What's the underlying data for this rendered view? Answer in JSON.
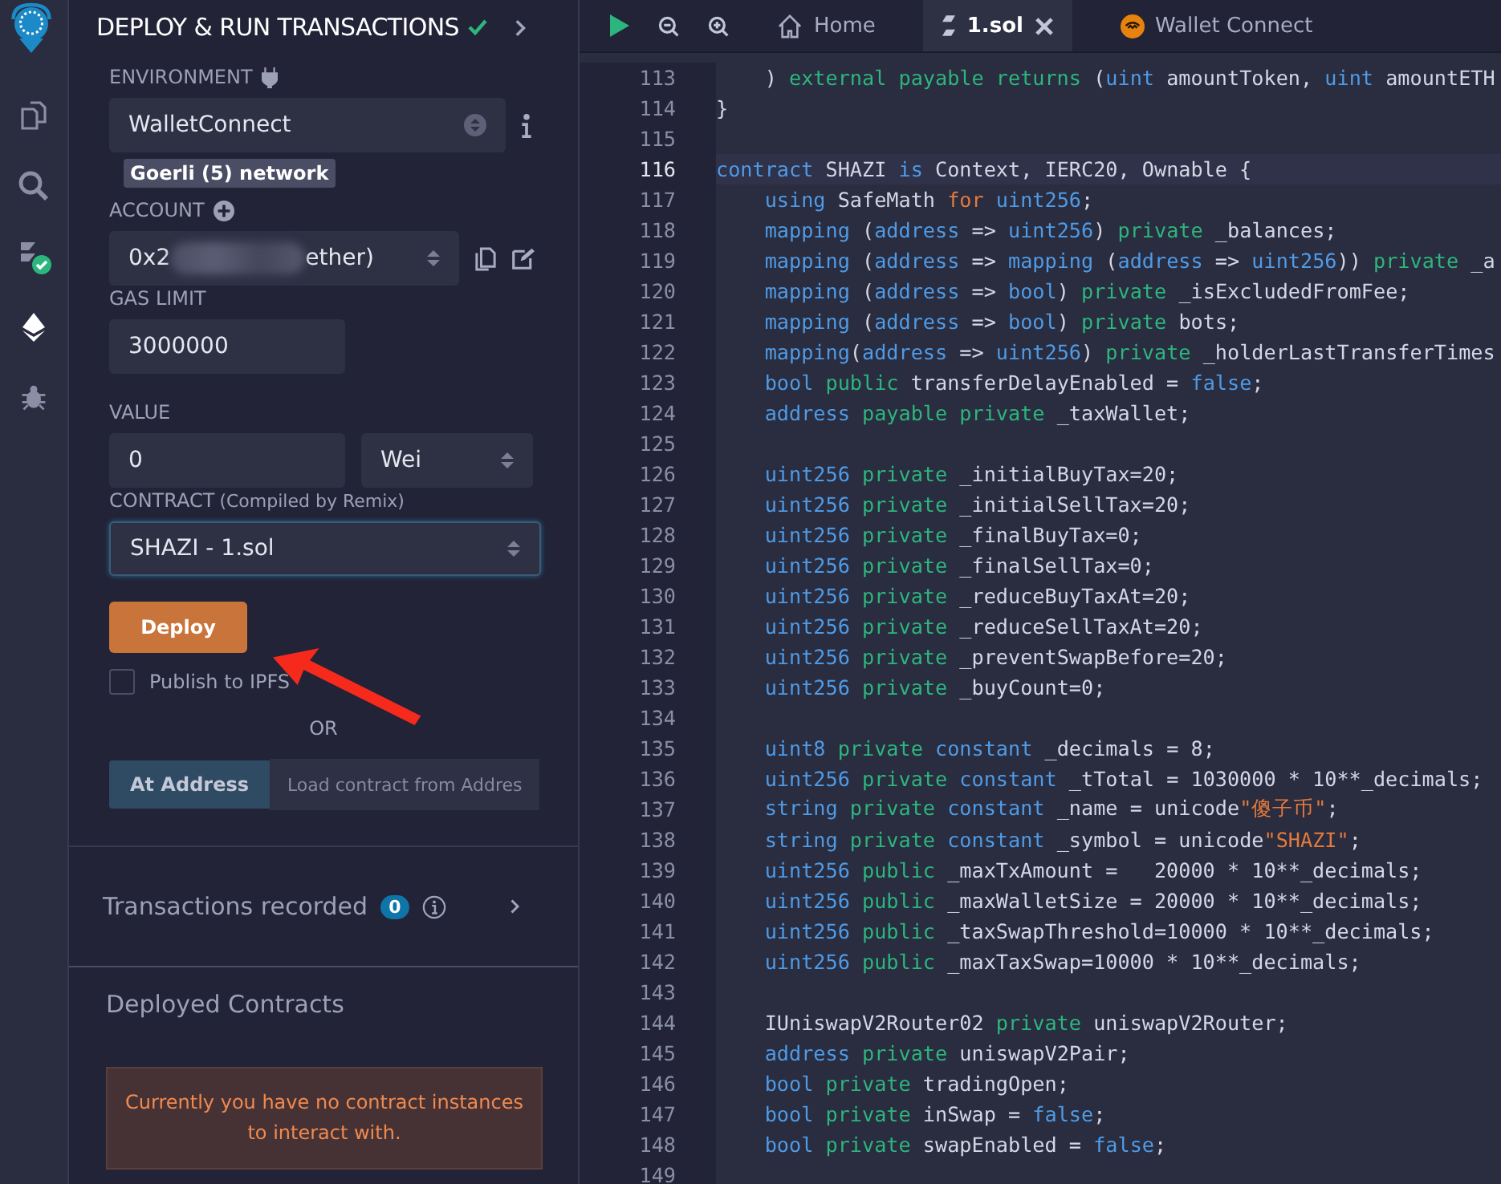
{
  "panel": {
    "title": "DEPLOY & RUN TRANSACTIONS",
    "environment_label": "ENVIRONMENT",
    "environment": "WalletConnect",
    "network": "Goerli (5) network",
    "account_label": "ACCOUNT",
    "account_start": "0x2",
    "account_end": "ether)",
    "gas_label": "GAS LIMIT",
    "gas": "3000000",
    "value_label": "VALUE",
    "value": "0",
    "unit": "Wei",
    "contract_label": "CONTRACT",
    "contract_note": "(Compiled by Remix)",
    "contract": "SHAZI - 1.sol",
    "deploy": "Deploy",
    "publish": {
      "label": "Publish to IPFS",
      "checked": false
    },
    "or": "OR",
    "at_address": "At Address",
    "address_placeholder": "Load contract from Addres",
    "transactions": "Transactions recorded",
    "tx_count": "0",
    "deployed": "Deployed Contracts",
    "empty_message": "Currently you have no contract instances to interact with."
  },
  "sidebar": {
    "items": [
      {
        "kind": "files",
        "selected": false
      },
      {
        "kind": "search",
        "selected": false
      },
      {
        "kind": "compiler",
        "selected": false
      },
      {
        "kind": "deploy",
        "selected": true
      },
      {
        "kind": "debug",
        "selected": false
      }
    ]
  },
  "tabs": [
    {
      "kind": "home",
      "label": "Home",
      "selected": false
    },
    {
      "kind": "file",
      "label": "1.sol",
      "selected": true
    },
    {
      "kind": "wallet",
      "label": "Wallet Connect",
      "selected": false
    }
  ],
  "editor": {
    "lines": [
      {
        "number": "113",
        "current": false,
        "tokens": [
          {
            "kind": "plain",
            "text": "    )"
          },
          {
            "kind": "modifier",
            "text": " external payable returns"
          },
          {
            "kind": "plain",
            "text": " ("
          },
          {
            "kind": "keyword",
            "text": "uint"
          },
          {
            "kind": "plain",
            "text": " amountToken,"
          },
          {
            "kind": "keyword",
            "text": " uint"
          },
          {
            "kind": "plain",
            "text": " amountETH"
          }
        ]
      },
      {
        "number": "114",
        "current": false,
        "tokens": [
          {
            "kind": "plain",
            "text": "}"
          }
        ]
      },
      {
        "number": "115",
        "current": false
      },
      {
        "number": "116",
        "current": true,
        "tokens": [
          {
            "kind": "keyword",
            "text": "contract"
          },
          {
            "kind": "plain",
            "text": " SHAZI"
          },
          {
            "kind": "keyword",
            "text": " is"
          },
          {
            "kind": "plain",
            "text": " Context, IERC20, Ownable {"
          }
        ]
      },
      {
        "number": "117",
        "current": false,
        "tokens": [
          {
            "kind": "keyword",
            "text": "    using"
          },
          {
            "kind": "plain",
            "text": " SafeMath"
          },
          {
            "kind": "string",
            "text": " for"
          },
          {
            "kind": "keyword",
            "text": " uint256"
          },
          {
            "kind": "plain",
            "text": ";"
          }
        ]
      },
      {
        "number": "118",
        "current": false,
        "tokens": [
          {
            "kind": "keyword",
            "text": "    mapping"
          },
          {
            "kind": "plain",
            "text": " ("
          },
          {
            "kind": "keyword",
            "text": "address"
          },
          {
            "kind": "plain",
            "text": " => "
          },
          {
            "kind": "keyword",
            "text": "uint256"
          },
          {
            "kind": "plain",
            "text": ")"
          },
          {
            "kind": "modifier",
            "text": " private"
          },
          {
            "kind": "plain",
            "text": " _balances;"
          }
        ]
      },
      {
        "number": "119",
        "current": false,
        "tokens": [
          {
            "kind": "keyword",
            "text": "    mapping"
          },
          {
            "kind": "plain",
            "text": " ("
          },
          {
            "kind": "keyword",
            "text": "address"
          },
          {
            "kind": "plain",
            "text": " => "
          },
          {
            "kind": "keyword",
            "text": "mapping"
          },
          {
            "kind": "plain",
            "text": " ("
          },
          {
            "kind": "keyword",
            "text": "address"
          },
          {
            "kind": "plain",
            "text": " => "
          },
          {
            "kind": "keyword",
            "text": "uint256"
          },
          {
            "kind": "plain",
            "text": "))"
          },
          {
            "kind": "modifier",
            "text": " private"
          },
          {
            "kind": "plain",
            "text": " _a"
          }
        ]
      },
      {
        "number": "120",
        "current": false,
        "tokens": [
          {
            "kind": "keyword",
            "text": "    mapping"
          },
          {
            "kind": "plain",
            "text": " ("
          },
          {
            "kind": "keyword",
            "text": "address"
          },
          {
            "kind": "plain",
            "text": " => "
          },
          {
            "kind": "keyword",
            "text": "bool"
          },
          {
            "kind": "plain",
            "text": ")"
          },
          {
            "kind": "modifier",
            "text": " private"
          },
          {
            "kind": "plain",
            "text": " _isExcludedFromFee;"
          }
        ]
      },
      {
        "number": "121",
        "current": false,
        "tokens": [
          {
            "kind": "keyword",
            "text": "    mapping"
          },
          {
            "kind": "plain",
            "text": " ("
          },
          {
            "kind": "keyword",
            "text": "address"
          },
          {
            "kind": "plain",
            "text": " => "
          },
          {
            "kind": "keyword",
            "text": "bool"
          },
          {
            "kind": "plain",
            "text": ")"
          },
          {
            "kind": "modifier",
            "text": " private"
          },
          {
            "kind": "plain",
            "text": " bots;"
          }
        ]
      },
      {
        "number": "122",
        "current": false,
        "tokens": [
          {
            "kind": "keyword",
            "text": "    mapping"
          },
          {
            "kind": "plain",
            "text": "("
          },
          {
            "kind": "keyword",
            "text": "address"
          },
          {
            "kind": "plain",
            "text": " => "
          },
          {
            "kind": "keyword",
            "text": "uint256"
          },
          {
            "kind": "plain",
            "text": ")"
          },
          {
            "kind": "modifier",
            "text": " private"
          },
          {
            "kind": "plain",
            "text": " _holderLastTransferTimes"
          }
        ]
      },
      {
        "number": "123",
        "current": false,
        "tokens": [
          {
            "kind": "keyword",
            "text": "    bool"
          },
          {
            "kind": "modifier",
            "text": " public"
          },
          {
            "kind": "plain",
            "text": " transferDelayEnabled = "
          },
          {
            "kind": "keyword",
            "text": "false"
          },
          {
            "kind": "plain",
            "text": ";"
          }
        ]
      },
      {
        "number": "124",
        "current": false,
        "tokens": [
          {
            "kind": "keyword",
            "text": "    address"
          },
          {
            "kind": "modifier",
            "text": " payable private"
          },
          {
            "kind": "plain",
            "text": " _taxWallet;"
          }
        ]
      },
      {
        "number": "125",
        "current": false
      },
      {
        "number": "126",
        "current": false,
        "tokens": [
          {
            "kind": "keyword",
            "text": "    uint256"
          },
          {
            "kind": "modifier",
            "text": " private"
          },
          {
            "kind": "plain",
            "text": " _initialBuyTax=20;"
          }
        ]
      },
      {
        "number": "127",
        "current": false,
        "tokens": [
          {
            "kind": "keyword",
            "text": "    uint256"
          },
          {
            "kind": "modifier",
            "text": " private"
          },
          {
            "kind": "plain",
            "text": " _initialSellTax=20;"
          }
        ]
      },
      {
        "number": "128",
        "current": false,
        "tokens": [
          {
            "kind": "keyword",
            "text": "    uint256"
          },
          {
            "kind": "modifier",
            "text": " private"
          },
          {
            "kind": "plain",
            "text": " _finalBuyTax=0;"
          }
        ]
      },
      {
        "number": "129",
        "current": false,
        "tokens": [
          {
            "kind": "keyword",
            "text": "    uint256"
          },
          {
            "kind": "modifier",
            "text": " private"
          },
          {
            "kind": "plain",
            "text": " _finalSellTax=0;"
          }
        ]
      },
      {
        "number": "130",
        "current": false,
        "tokens": [
          {
            "kind": "keyword",
            "text": "    uint256"
          },
          {
            "kind": "modifier",
            "text": " private"
          },
          {
            "kind": "plain",
            "text": " _reduceBuyTaxAt=20;"
          }
        ]
      },
      {
        "number": "131",
        "current": false,
        "tokens": [
          {
            "kind": "keyword",
            "text": "    uint256"
          },
          {
            "kind": "modifier",
            "text": " private"
          },
          {
            "kind": "plain",
            "text": " _reduceSellTaxAt=20;"
          }
        ]
      },
      {
        "number": "132",
        "current": false,
        "tokens": [
          {
            "kind": "keyword",
            "text": "    uint256"
          },
          {
            "kind": "modifier",
            "text": " private"
          },
          {
            "kind": "plain",
            "text": " _preventSwapBefore=20;"
          }
        ]
      },
      {
        "number": "133",
        "current": false,
        "tokens": [
          {
            "kind": "keyword",
            "text": "    uint256"
          },
          {
            "kind": "modifier",
            "text": " private"
          },
          {
            "kind": "plain",
            "text": " _buyCount=0;"
          }
        ]
      },
      {
        "number": "134",
        "current": false
      },
      {
        "number": "135",
        "current": false,
        "tokens": [
          {
            "kind": "keyword",
            "text": "    uint8"
          },
          {
            "kind": "modifier",
            "text": " private"
          },
          {
            "kind": "keyword",
            "text": " constant"
          },
          {
            "kind": "plain",
            "text": " _decimals = 8;"
          }
        ]
      },
      {
        "number": "136",
        "current": false,
        "tokens": [
          {
            "kind": "keyword",
            "text": "    uint256"
          },
          {
            "kind": "modifier",
            "text": " private"
          },
          {
            "kind": "keyword",
            "text": " constant"
          },
          {
            "kind": "plain",
            "text": " _tTotal = 1030000 * 10**_decimals;"
          }
        ]
      },
      {
        "number": "137",
        "current": false,
        "tokens": [
          {
            "kind": "keyword",
            "text": "    string"
          },
          {
            "kind": "modifier",
            "text": " private"
          },
          {
            "kind": "keyword",
            "text": " constant"
          },
          {
            "kind": "plain",
            "text": " _name = unicode"
          },
          {
            "kind": "string",
            "text": "\"傻子币\""
          },
          {
            "kind": "plain",
            "text": ";"
          }
        ]
      },
      {
        "number": "138",
        "current": false,
        "tokens": [
          {
            "kind": "keyword",
            "text": "    string"
          },
          {
            "kind": "modifier",
            "text": " private"
          },
          {
            "kind": "keyword",
            "text": " constant"
          },
          {
            "kind": "plain",
            "text": " _symbol = unicode"
          },
          {
            "kind": "string",
            "text": "\"SHAZI\""
          },
          {
            "kind": "plain",
            "text": ";"
          }
        ]
      },
      {
        "number": "139",
        "current": false,
        "tokens": [
          {
            "kind": "keyword",
            "text": "    uint256"
          },
          {
            "kind": "modifier",
            "text": " public"
          },
          {
            "kind": "plain",
            "text": " _maxTxAmount =   20000 * 10**_decimals;"
          }
        ]
      },
      {
        "number": "140",
        "current": false,
        "tokens": [
          {
            "kind": "keyword",
            "text": "    uint256"
          },
          {
            "kind": "modifier",
            "text": " public"
          },
          {
            "kind": "plain",
            "text": " _maxWalletSize = 20000 * 10**_decimals;"
          }
        ]
      },
      {
        "number": "141",
        "current": false,
        "tokens": [
          {
            "kind": "keyword",
            "text": "    uint256"
          },
          {
            "kind": "modifier",
            "text": " public"
          },
          {
            "kind": "plain",
            "text": " _taxSwapThreshold=10000 * 10**_decimals;"
          }
        ]
      },
      {
        "number": "142",
        "current": false,
        "tokens": [
          {
            "kind": "keyword",
            "text": "    uint256"
          },
          {
            "kind": "modifier",
            "text": " public"
          },
          {
            "kind": "plain",
            "text": " _maxTaxSwap=10000 * 10**_decimals;"
          }
        ]
      },
      {
        "number": "143",
        "current": false
      },
      {
        "number": "144",
        "current": false,
        "tokens": [
          {
            "kind": "plain",
            "text": "    IUniswapV2Router02"
          },
          {
            "kind": "modifier",
            "text": " private"
          },
          {
            "kind": "plain",
            "text": " uniswapV2Router;"
          }
        ]
      },
      {
        "number": "145",
        "current": false,
        "tokens": [
          {
            "kind": "keyword",
            "text": "    address"
          },
          {
            "kind": "modifier",
            "text": " private"
          },
          {
            "kind": "plain",
            "text": " uniswapV2Pair;"
          }
        ]
      },
      {
        "number": "146",
        "current": false,
        "tokens": [
          {
            "kind": "keyword",
            "text": "    bool"
          },
          {
            "kind": "modifier",
            "text": " private"
          },
          {
            "kind": "plain",
            "text": " tradingOpen;"
          }
        ]
      },
      {
        "number": "147",
        "current": false,
        "tokens": [
          {
            "kind": "keyword",
            "text": "    bool"
          },
          {
            "kind": "modifier",
            "text": " private"
          },
          {
            "kind": "plain",
            "text": " inSwap = "
          },
          {
            "kind": "keyword",
            "text": "false"
          },
          {
            "kind": "plain",
            "text": ";"
          }
        ]
      },
      {
        "number": "148",
        "current": false,
        "tokens": [
          {
            "kind": "keyword",
            "text": "    bool"
          },
          {
            "kind": "modifier",
            "text": " private"
          },
          {
            "kind": "plain",
            "text": " swapEnabled = "
          },
          {
            "kind": "keyword",
            "text": "false"
          },
          {
            "kind": "plain",
            "text": ";"
          }
        ]
      },
      {
        "number": "149",
        "current": false
      }
    ]
  }
}
